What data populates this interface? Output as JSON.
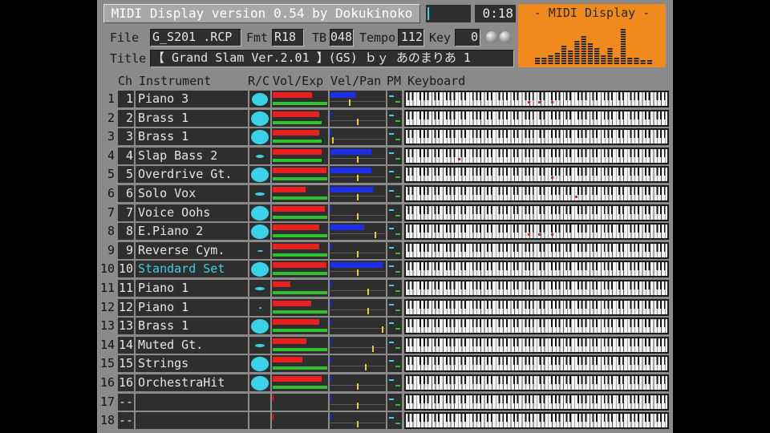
{
  "header": {
    "title": "MIDI Display  version 0.54  by Dokukinoko",
    "time": "0:18",
    "progress": 0.02,
    "file_label": "File",
    "file_value": "G_S201  .RCP",
    "fmt_label": "Fmt",
    "fmt_value": "R18",
    "tb_label": "TB",
    "tb_value": "048",
    "tempo_label": "Tempo",
    "tempo_value": "112",
    "key_label": "Key",
    "key_value": "0",
    "title_label": "Title",
    "title_value": "【 Grand Slam Ver.2.01  】(GS) ｂｙ あのまりあ  1"
  },
  "display_panel": {
    "title": "- MIDI Display -",
    "color": "#f08a1c",
    "levels": [
      0.15,
      0.15,
      0.25,
      0.3,
      0.45,
      0.35,
      0.6,
      0.7,
      0.5,
      0.4,
      0.25,
      0.4,
      0.2,
      0.85,
      0.15,
      0.2,
      0.1,
      0.1
    ]
  },
  "columns": {
    "ch": "Ch",
    "instrument": "Instrument",
    "rc": "R/C",
    "vol_exp": "Vol/Exp",
    "vel_pan": "Vel/Pan",
    "pm": "PM",
    "keyboard": "Keyboard"
  },
  "colors": {
    "accent": "#3ad2e6",
    "volume": "#e82020",
    "expression": "#2ec22e",
    "velocity": "#1c2ee6",
    "pan": "#e6d21a",
    "note": "#e82020"
  },
  "channels": [
    {
      "row": "1",
      "ch": "1",
      "instrument": "Piano 3",
      "rc": 0.9,
      "vol": 0.72,
      "exp": 1.0,
      "vel": 0.45,
      "pan": 0.35,
      "drum": false,
      "notes": [
        0.47,
        0.51,
        0.56
      ]
    },
    {
      "row": "2",
      "ch": "2",
      "instrument": "Brass 1",
      "rc": 1.0,
      "vol": 0.85,
      "exp": 0.9,
      "vel": 0.02,
      "pan": 0.5,
      "drum": false,
      "notes": []
    },
    {
      "row": "3",
      "ch": "3",
      "instrument": "Brass 1",
      "rc": 1.0,
      "vol": 0.85,
      "exp": 0.9,
      "vel": 0.02,
      "pan": 0.02,
      "drum": false,
      "notes": []
    },
    {
      "row": "4",
      "ch": "4",
      "instrument": "Slap Bass 2",
      "rc": 0.45,
      "vol": 0.9,
      "exp": 0.9,
      "vel": 0.75,
      "pan": 0.5,
      "drum": false,
      "notes": [
        0.2
      ]
    },
    {
      "row": "5",
      "ch": "5",
      "instrument": "Overdrive Gt.",
      "rc": 1.0,
      "vol": 0.98,
      "exp": 1.0,
      "vel": 0.75,
      "pan": 0.5,
      "drum": false,
      "notes": [
        0.56
      ]
    },
    {
      "row": "6",
      "ch": "6",
      "instrument": "Solo Vox",
      "rc": 0.55,
      "vol": 0.6,
      "exp": 1.0,
      "vel": 0.78,
      "pan": 0.5,
      "drum": false,
      "notes": [
        0.65
      ]
    },
    {
      "row": "7",
      "ch": "7",
      "instrument": "Voice Oohs",
      "rc": 1.0,
      "vol": 0.95,
      "exp": 1.0,
      "vel": 0.02,
      "pan": 0.5,
      "drum": false,
      "notes": []
    },
    {
      "row": "8",
      "ch": "8",
      "instrument": "E.Piano 2",
      "rc": 1.0,
      "vol": 0.85,
      "exp": 1.0,
      "vel": 0.62,
      "pan": 0.85,
      "drum": false,
      "notes": [
        0.47,
        0.51,
        0.56
      ]
    },
    {
      "row": "9",
      "ch": "9",
      "instrument": "Reverse Cym.",
      "rc": 0.3,
      "vol": 0.85,
      "exp": 1.0,
      "vel": 0.02,
      "pan": 0.5,
      "drum": false,
      "notes": []
    },
    {
      "row": "10",
      "ch": "10",
      "instrument": "Standard Set",
      "rc": 1.0,
      "vol": 0.98,
      "exp": 1.0,
      "vel": 0.95,
      "pan": 0.5,
      "drum": true,
      "notes": []
    },
    {
      "row": "11",
      "ch": "11",
      "instrument": "Piano 1",
      "rc": 0.55,
      "vol": 0.32,
      "exp": 1.0,
      "vel": 0.02,
      "pan": 0.7,
      "drum": false,
      "notes": []
    },
    {
      "row": "12",
      "ch": "12",
      "instrument": "Piano 1",
      "rc": 0.12,
      "vol": 0.7,
      "exp": 1.0,
      "vel": 0.02,
      "pan": 0.7,
      "drum": false,
      "notes": []
    },
    {
      "row": "13",
      "ch": "13",
      "instrument": "Brass 1",
      "rc": 1.0,
      "vol": 0.85,
      "exp": 1.0,
      "vel": 0.02,
      "pan": 0.98,
      "drum": false,
      "notes": []
    },
    {
      "row": "14",
      "ch": "14",
      "instrument": "Muted Gt.",
      "rc": 0.55,
      "vol": 0.62,
      "exp": 1.0,
      "vel": 0.02,
      "pan": 0.8,
      "drum": false,
      "notes": []
    },
    {
      "row": "15",
      "ch": "15",
      "instrument": "Strings",
      "rc": 1.0,
      "vol": 0.55,
      "exp": 1.0,
      "vel": 0.02,
      "pan": 0.65,
      "drum": false,
      "notes": []
    },
    {
      "row": "16",
      "ch": "16",
      "instrument": "OrchestraHit",
      "rc": 1.0,
      "vol": 0.9,
      "exp": 1.0,
      "vel": 0.02,
      "pan": 0.5,
      "drum": false,
      "notes": []
    },
    {
      "row": "17",
      "ch": "--",
      "instrument": "",
      "rc": 0,
      "vol": 0.02,
      "exp": 0,
      "vel": 0,
      "pan": 0.5,
      "drum": false,
      "notes": []
    },
    {
      "row": "18",
      "ch": "--",
      "instrument": "",
      "rc": 0,
      "vol": 0.02,
      "exp": 0,
      "vel": 0,
      "pan": 0.5,
      "drum": false,
      "notes": []
    }
  ]
}
